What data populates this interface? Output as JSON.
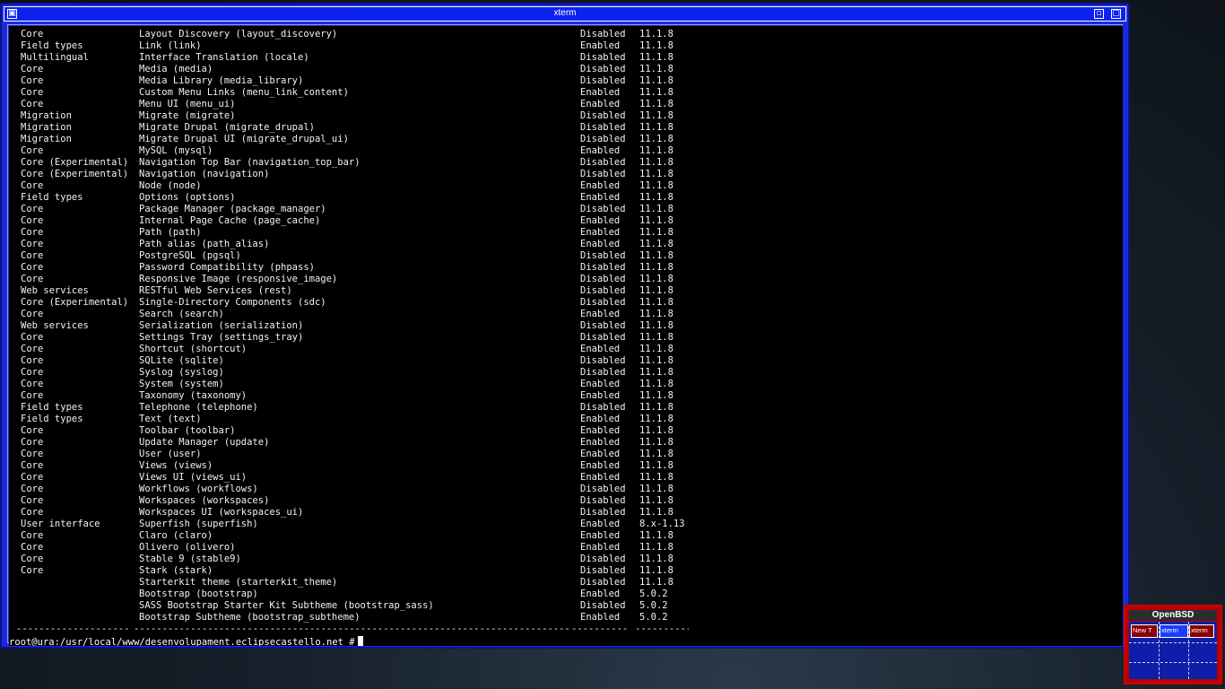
{
  "window": {
    "title": "xterm",
    "menu_icon": "terminal-menu-icon",
    "iconify_icon": "iconify-icon",
    "maximize_icon": "maximize-icon"
  },
  "terminal": {
    "rows": [
      [
        "Core",
        "Layout Discovery (layout_discovery)",
        "Disabled",
        "11.1.8"
      ],
      [
        "Field types",
        "Link (link)",
        "Enabled",
        "11.1.8"
      ],
      [
        "Multilingual",
        "Interface Translation (locale)",
        "Disabled",
        "11.1.8"
      ],
      [
        "Core",
        "Media (media)",
        "Disabled",
        "11.1.8"
      ],
      [
        "Core",
        "Media Library (media_library)",
        "Disabled",
        "11.1.8"
      ],
      [
        "Core",
        "Custom Menu Links (menu_link_content)",
        "Enabled",
        "11.1.8"
      ],
      [
        "Core",
        "Menu UI (menu_ui)",
        "Enabled",
        "11.1.8"
      ],
      [
        "Migration",
        "Migrate (migrate)",
        "Disabled",
        "11.1.8"
      ],
      [
        "Migration",
        "Migrate Drupal (migrate_drupal)",
        "Disabled",
        "11.1.8"
      ],
      [
        "Migration",
        "Migrate Drupal UI (migrate_drupal_ui)",
        "Disabled",
        "11.1.8"
      ],
      [
        "Core",
        "MySQL (mysql)",
        "Enabled",
        "11.1.8"
      ],
      [
        "Core (Experimental)",
        "Navigation Top Bar (navigation_top_bar)",
        "Disabled",
        "11.1.8"
      ],
      [
        "Core (Experimental)",
        "Navigation (navigation)",
        "Disabled",
        "11.1.8"
      ],
      [
        "Core",
        "Node (node)",
        "Enabled",
        "11.1.8"
      ],
      [
        "Field types",
        "Options (options)",
        "Enabled",
        "11.1.8"
      ],
      [
        "Core",
        "Package Manager (package_manager)",
        "Disabled",
        "11.1.8"
      ],
      [
        "Core",
        "Internal Page Cache (page_cache)",
        "Enabled",
        "11.1.8"
      ],
      [
        "Core",
        "Path (path)",
        "Enabled",
        "11.1.8"
      ],
      [
        "Core",
        "Path alias (path_alias)",
        "Enabled",
        "11.1.8"
      ],
      [
        "Core",
        "PostgreSQL (pgsql)",
        "Disabled",
        "11.1.8"
      ],
      [
        "Core",
        "Password Compatibility (phpass)",
        "Disabled",
        "11.1.8"
      ],
      [
        "Core",
        "Responsive Image (responsive_image)",
        "Disabled",
        "11.1.8"
      ],
      [
        "Web services",
        "RESTful Web Services (rest)",
        "Disabled",
        "11.1.8"
      ],
      [
        "Core (Experimental)",
        "Single-Directory Components (sdc)",
        "Disabled",
        "11.1.8"
      ],
      [
        "Core",
        "Search (search)",
        "Enabled",
        "11.1.8"
      ],
      [
        "Web services",
        "Serialization (serialization)",
        "Disabled",
        "11.1.8"
      ],
      [
        "Core",
        "Settings Tray (settings_tray)",
        "Disabled",
        "11.1.8"
      ],
      [
        "Core",
        "Shortcut (shortcut)",
        "Enabled",
        "11.1.8"
      ],
      [
        "Core",
        "SQLite (sqlite)",
        "Disabled",
        "11.1.8"
      ],
      [
        "Core",
        "Syslog (syslog)",
        "Disabled",
        "11.1.8"
      ],
      [
        "Core",
        "System (system)",
        "Enabled",
        "11.1.8"
      ],
      [
        "Core",
        "Taxonomy (taxonomy)",
        "Enabled",
        "11.1.8"
      ],
      [
        "Field types",
        "Telephone (telephone)",
        "Disabled",
        "11.1.8"
      ],
      [
        "Field types",
        "Text (text)",
        "Enabled",
        "11.1.8"
      ],
      [
        "Core",
        "Toolbar (toolbar)",
        "Enabled",
        "11.1.8"
      ],
      [
        "Core",
        "Update Manager (update)",
        "Enabled",
        "11.1.8"
      ],
      [
        "Core",
        "User (user)",
        "Enabled",
        "11.1.8"
      ],
      [
        "Core",
        "Views (views)",
        "Enabled",
        "11.1.8"
      ],
      [
        "Core",
        "Views UI (views_ui)",
        "Enabled",
        "11.1.8"
      ],
      [
        "Core",
        "Workflows (workflows)",
        "Disabled",
        "11.1.8"
      ],
      [
        "Core",
        "Workspaces (workspaces)",
        "Disabled",
        "11.1.8"
      ],
      [
        "Core",
        "Workspaces UI (workspaces_ui)",
        "Disabled",
        "11.1.8"
      ],
      [
        "User interface",
        "Superfish (superfish)",
        "Enabled",
        "8.x-1.13"
      ],
      [
        "Core",
        "Claro (claro)",
        "Enabled",
        "11.1.8"
      ],
      [
        "Core",
        "Olivero (olivero)",
        "Enabled",
        "11.1.8"
      ],
      [
        "Core",
        "Stable 9 (stable9)",
        "Disabled",
        "11.1.8"
      ],
      [
        "Core",
        "Stark (stark)",
        "Disabled",
        "11.1.8"
      ],
      [
        "",
        "Starterkit theme (starterkit_theme)",
        "Disabled",
        "11.1.8"
      ],
      [
        "",
        "Bootstrap (bootstrap)",
        "Enabled",
        "5.0.2"
      ],
      [
        "",
        "SASS Bootstrap Starter Kit Subtheme (bootstrap_sass)",
        "Disabled",
        "5.0.2"
      ],
      [
        "",
        "Bootstrap Subtheme (bootstrap_subtheme)",
        "Enabled",
        "5.0.2"
      ]
    ],
    "separator": [
      "--------------------",
      "----------------------------------------------------------------------------------",
      "----------",
      "----------"
    ],
    "prompt": "root@ura:/usr/local/www/desenvolupament.eclipsecastello.net #"
  },
  "pager": {
    "title": "OpenBSD",
    "windows": [
      "New T",
      "xterm",
      "xterm"
    ],
    "colors": {
      "frame": "#b80000",
      "desk": "#0d1ea8",
      "active": "#1a3cff",
      "inactive": "#8a0000"
    }
  }
}
